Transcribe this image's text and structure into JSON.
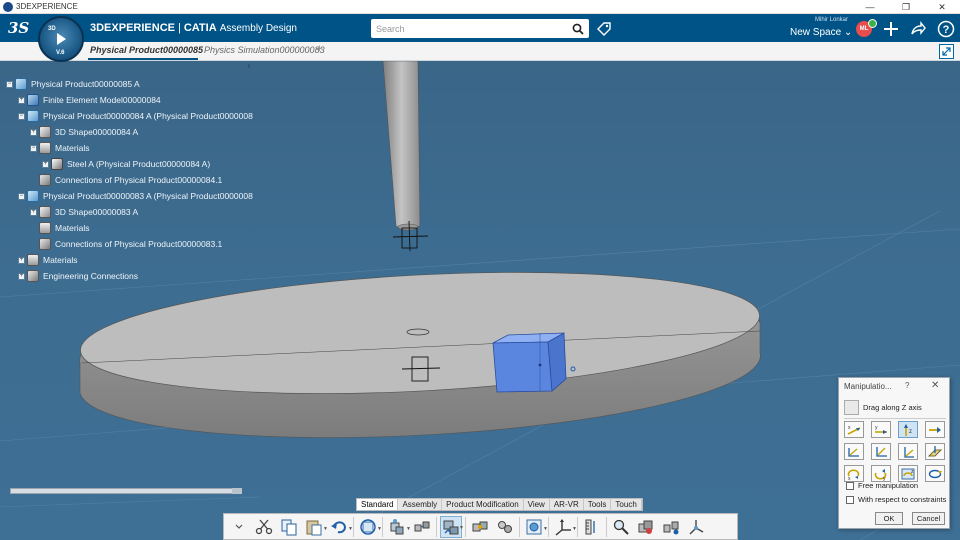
{
  "window": {
    "title": "3DEXPERIENCE",
    "buttons": [
      "—",
      "❐",
      "✕"
    ]
  },
  "header": {
    "brand_bold": "3DEXPERIENCE",
    "brand_sep": "|",
    "brand_product": "CATIA",
    "brand_app": "Assembly Design",
    "compass_version": "V.6",
    "compass_3d": "3D",
    "search_placeholder": "Search",
    "user_name": "Mihir Lonkar",
    "space_label": "New Space ⌄",
    "avatar_initials": "ML"
  },
  "tabs": [
    {
      "label": "Physical Product00000085",
      "active": true
    },
    {
      "label": "Physics Simulation000000083",
      "active": false
    }
  ],
  "tabs_add": "+",
  "tree": {
    "collapse_glyph": "‹",
    "rows": [
      {
        "label": "Physical Product00000085 A",
        "icon": "product-icon",
        "exp": "−"
      },
      {
        "label": "Finite Element Model00000084",
        "icon": "fem-icon",
        "exp": "+"
      },
      {
        "label": "Physical Product00000084 A (Physical Product0000008",
        "icon": "product-icon",
        "exp": "−"
      },
      {
        "label": "3D Shape00000084 A",
        "icon": "shape-icon",
        "exp": "+"
      },
      {
        "label": "Materials",
        "icon": "folder-icon",
        "exp": "−"
      },
      {
        "label": "Steel A (Physical Product00000084 A)",
        "icon": "material-icon",
        "exp": "+"
      },
      {
        "label": "Connections of Physical Product00000084.1",
        "icon": "connections-icon",
        "exp": ""
      },
      {
        "label": "Physical Product00000083 A (Physical Product0000008",
        "icon": "product-icon",
        "exp": "−"
      },
      {
        "label": "3D Shape00000083 A",
        "icon": "shape-icon",
        "exp": "+"
      },
      {
        "label": "Materials",
        "icon": "folder-icon",
        "exp": ""
      },
      {
        "label": "Connections of Physical Product00000083.1",
        "icon": "connections-icon",
        "exp": ""
      },
      {
        "label": "Materials",
        "icon": "folder-icon",
        "exp": "+"
      },
      {
        "label": "Engineering Connections",
        "icon": "connections-icon",
        "exp": "+"
      }
    ]
  },
  "section_tabs": [
    "Standard",
    "Assembly",
    "Product Modification",
    "View",
    "AR-VR",
    "Tools",
    "Touch"
  ],
  "section_tabs_active": "Standard",
  "manipulation": {
    "title": "Manipulatio...",
    "help": "?",
    "close": "✕",
    "mode": "Drag along Z axis",
    "free_manipulation": "Free manipulation",
    "with_constraints": "With respect to constraints",
    "ok": "OK",
    "cancel": "Cancel"
  },
  "colors": {
    "header": "#005386",
    "viewport": "#3d6d91",
    "selected_box": "#5b86e0"
  }
}
